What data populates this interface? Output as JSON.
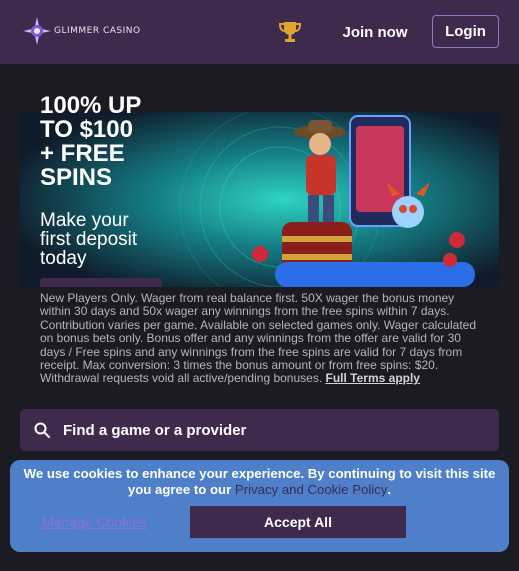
{
  "header": {
    "logo_text": "GLIMMER CASINO",
    "trophy_icon": "trophy-icon",
    "join_label": "Join now",
    "login_label": "Login"
  },
  "hero": {
    "headline_line1": "100% UP",
    "headline_line2": "TO $100",
    "headline_line3": "+ FREE",
    "headline_line4": "SPINS",
    "sub_line1": "Make your",
    "sub_line2": "first deposit",
    "sub_line3": "today"
  },
  "terms": {
    "text": "New Players Only. Wager from real balance first. 50X wager the bonus money within 30 days and 50x wager any winnings from the free spins within 7 days. Contribution varies per game. Available on selected games only. Wager calculated on bonus bets only. Bonus offer and any winnings from the offer are valid for 30 days / Free spins and any winnings from the free spins are valid for 7 days from receipt. Max conversion: 3 times the bonus amount or from free spins: $20. Withdrawal requests void all active/pending bonuses.",
    "link_label": "Full Terms apply"
  },
  "search": {
    "placeholder": "Find a game or a provider",
    "icon": "search-icon"
  },
  "cookie": {
    "text": "We use cookies to enhance your experience. By continuing to visit this site you agree to our",
    "policy_link": "Privacy and Cookie Policy",
    "period": ".",
    "manage_label": "Manage Cookies",
    "accept_label": "Accept All"
  },
  "colors": {
    "header_bg": "#3d2a4d",
    "page_bg": "#1b1b24",
    "cookie_bg": "#4f7fc9",
    "button_bg": "#3d2a4d",
    "login_border": "#8a7fc6",
    "trophy": "#e2a52b"
  }
}
